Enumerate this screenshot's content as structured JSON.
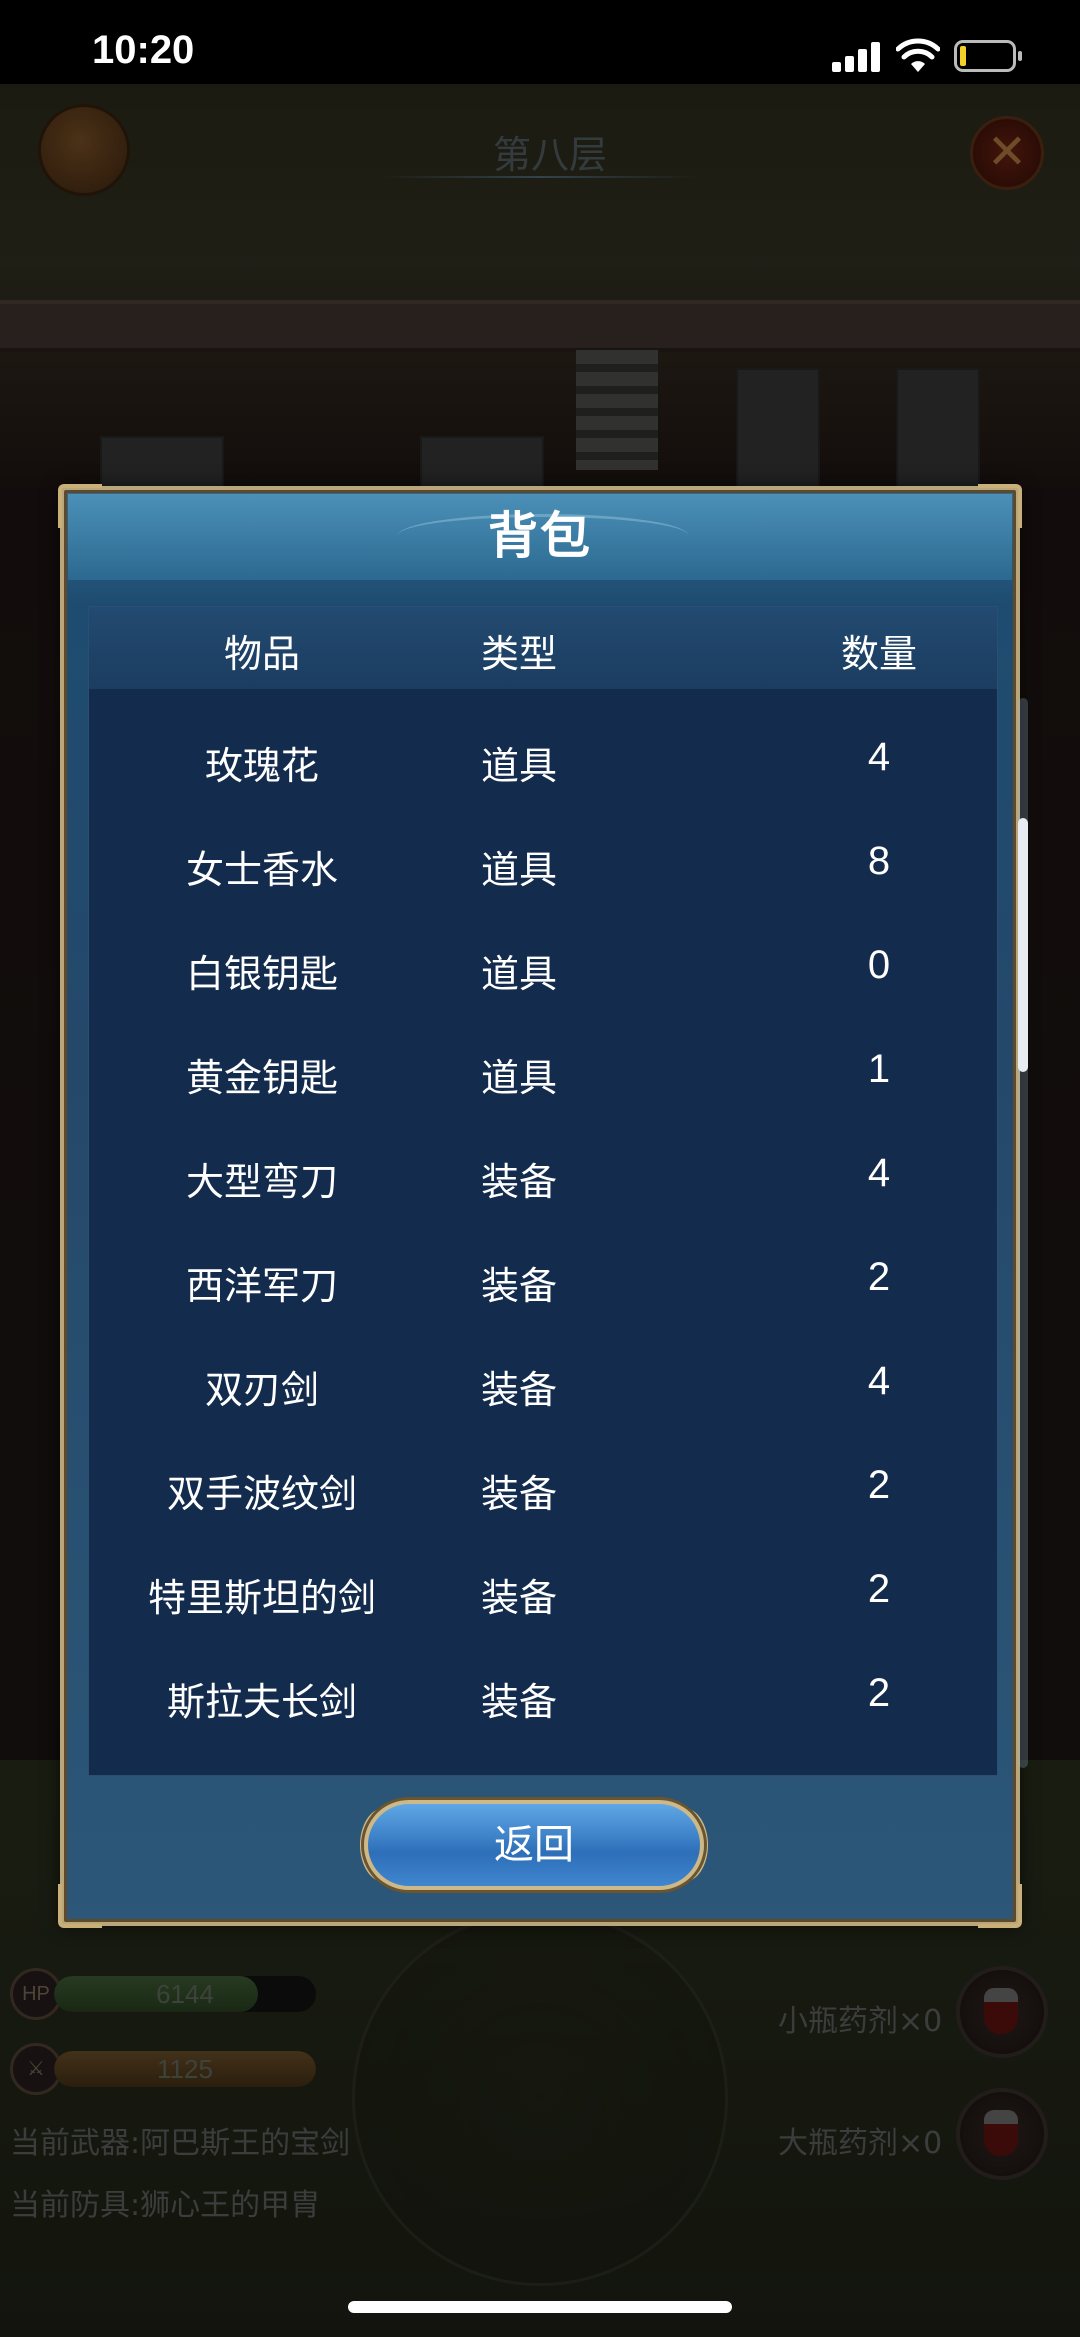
{
  "status_bar": {
    "time": "10:20"
  },
  "game": {
    "floor_title": "第八层",
    "hud": {
      "hp_label": "HP",
      "hp_value": "6144",
      "hp_fill_fraction": 0.78,
      "attack_value": "1125",
      "attack_fill_fraction": 1.0,
      "current_weapon": "当前武器:阿巴斯王的宝剑",
      "current_armor": "当前防具:狮心王的甲胄",
      "small_potion": "小瓶药剂×0",
      "large_potion": "大瓶药剂×0"
    }
  },
  "modal": {
    "title": "背包",
    "columns": [
      "物品",
      "类型",
      "数量"
    ],
    "rows": [
      {
        "item": "玫瑰花",
        "type": "道具",
        "qty": "4"
      },
      {
        "item": "女士香水",
        "type": "道具",
        "qty": "8"
      },
      {
        "item": "白银钥匙",
        "type": "道具",
        "qty": "0"
      },
      {
        "item": "黄金钥匙",
        "type": "道具",
        "qty": "1"
      },
      {
        "item": "大型弯刀",
        "type": "装备",
        "qty": "4"
      },
      {
        "item": "西洋军刀",
        "type": "装备",
        "qty": "2"
      },
      {
        "item": "双刃剑",
        "type": "装备",
        "qty": "4"
      },
      {
        "item": "双手波纹剑",
        "type": "装备",
        "qty": "2"
      },
      {
        "item": "特里斯坦的剑",
        "type": "装备",
        "qty": "2"
      },
      {
        "item": "斯拉夫长剑",
        "type": "装备",
        "qty": "2"
      }
    ],
    "back_label": "返回"
  },
  "colors": {
    "modal_border": "#b9a67a",
    "table_bg": "#132b4c",
    "button_blue": "#3f86cf"
  }
}
